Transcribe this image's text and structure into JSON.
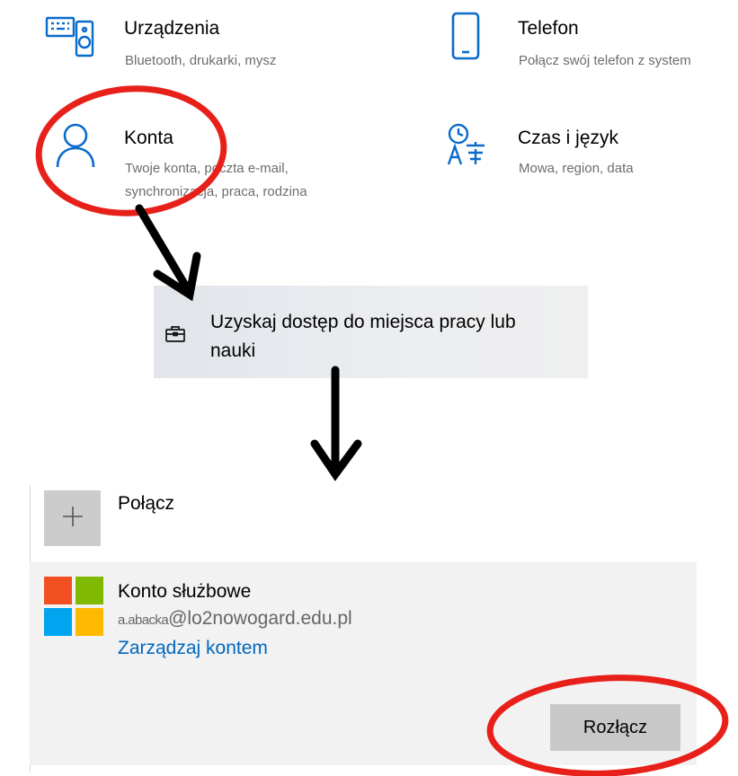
{
  "tiles": {
    "devices": {
      "title": "Urządzenia",
      "subtitle": "Bluetooth, drukarki, mysz"
    },
    "phone": {
      "title": "Telefon",
      "subtitle": "Połącz swój telefon z system"
    },
    "accounts": {
      "title": "Konta",
      "subtitle_line1": "Twoje konta, poczta e-mail,",
      "subtitle_line2": "synchronizacja, praca, rodzina"
    },
    "time_language": {
      "title": "Czas i język",
      "subtitle": "Mowa, region, data"
    }
  },
  "access_item": {
    "line1": "Uzyskaj dostęp do miejsca pracy lub",
    "line2": "nauki",
    "icon": "briefcase-icon"
  },
  "connect": {
    "label": "Połącz",
    "icon": "plus-icon"
  },
  "account": {
    "title": "Konto służbowe",
    "email_user": "a.abacka",
    "email_domain": "@lo2nowogard.edu.pl",
    "manage_link": "Zarządzaj kontem",
    "disconnect_label": "Rozłącz",
    "logo_colors": [
      "#f25022",
      "#7fba00",
      "#00a4ef",
      "#ffb900"
    ]
  },
  "annotations": {
    "highlight_color": "#e8201a",
    "arrow_color": "#000000"
  }
}
